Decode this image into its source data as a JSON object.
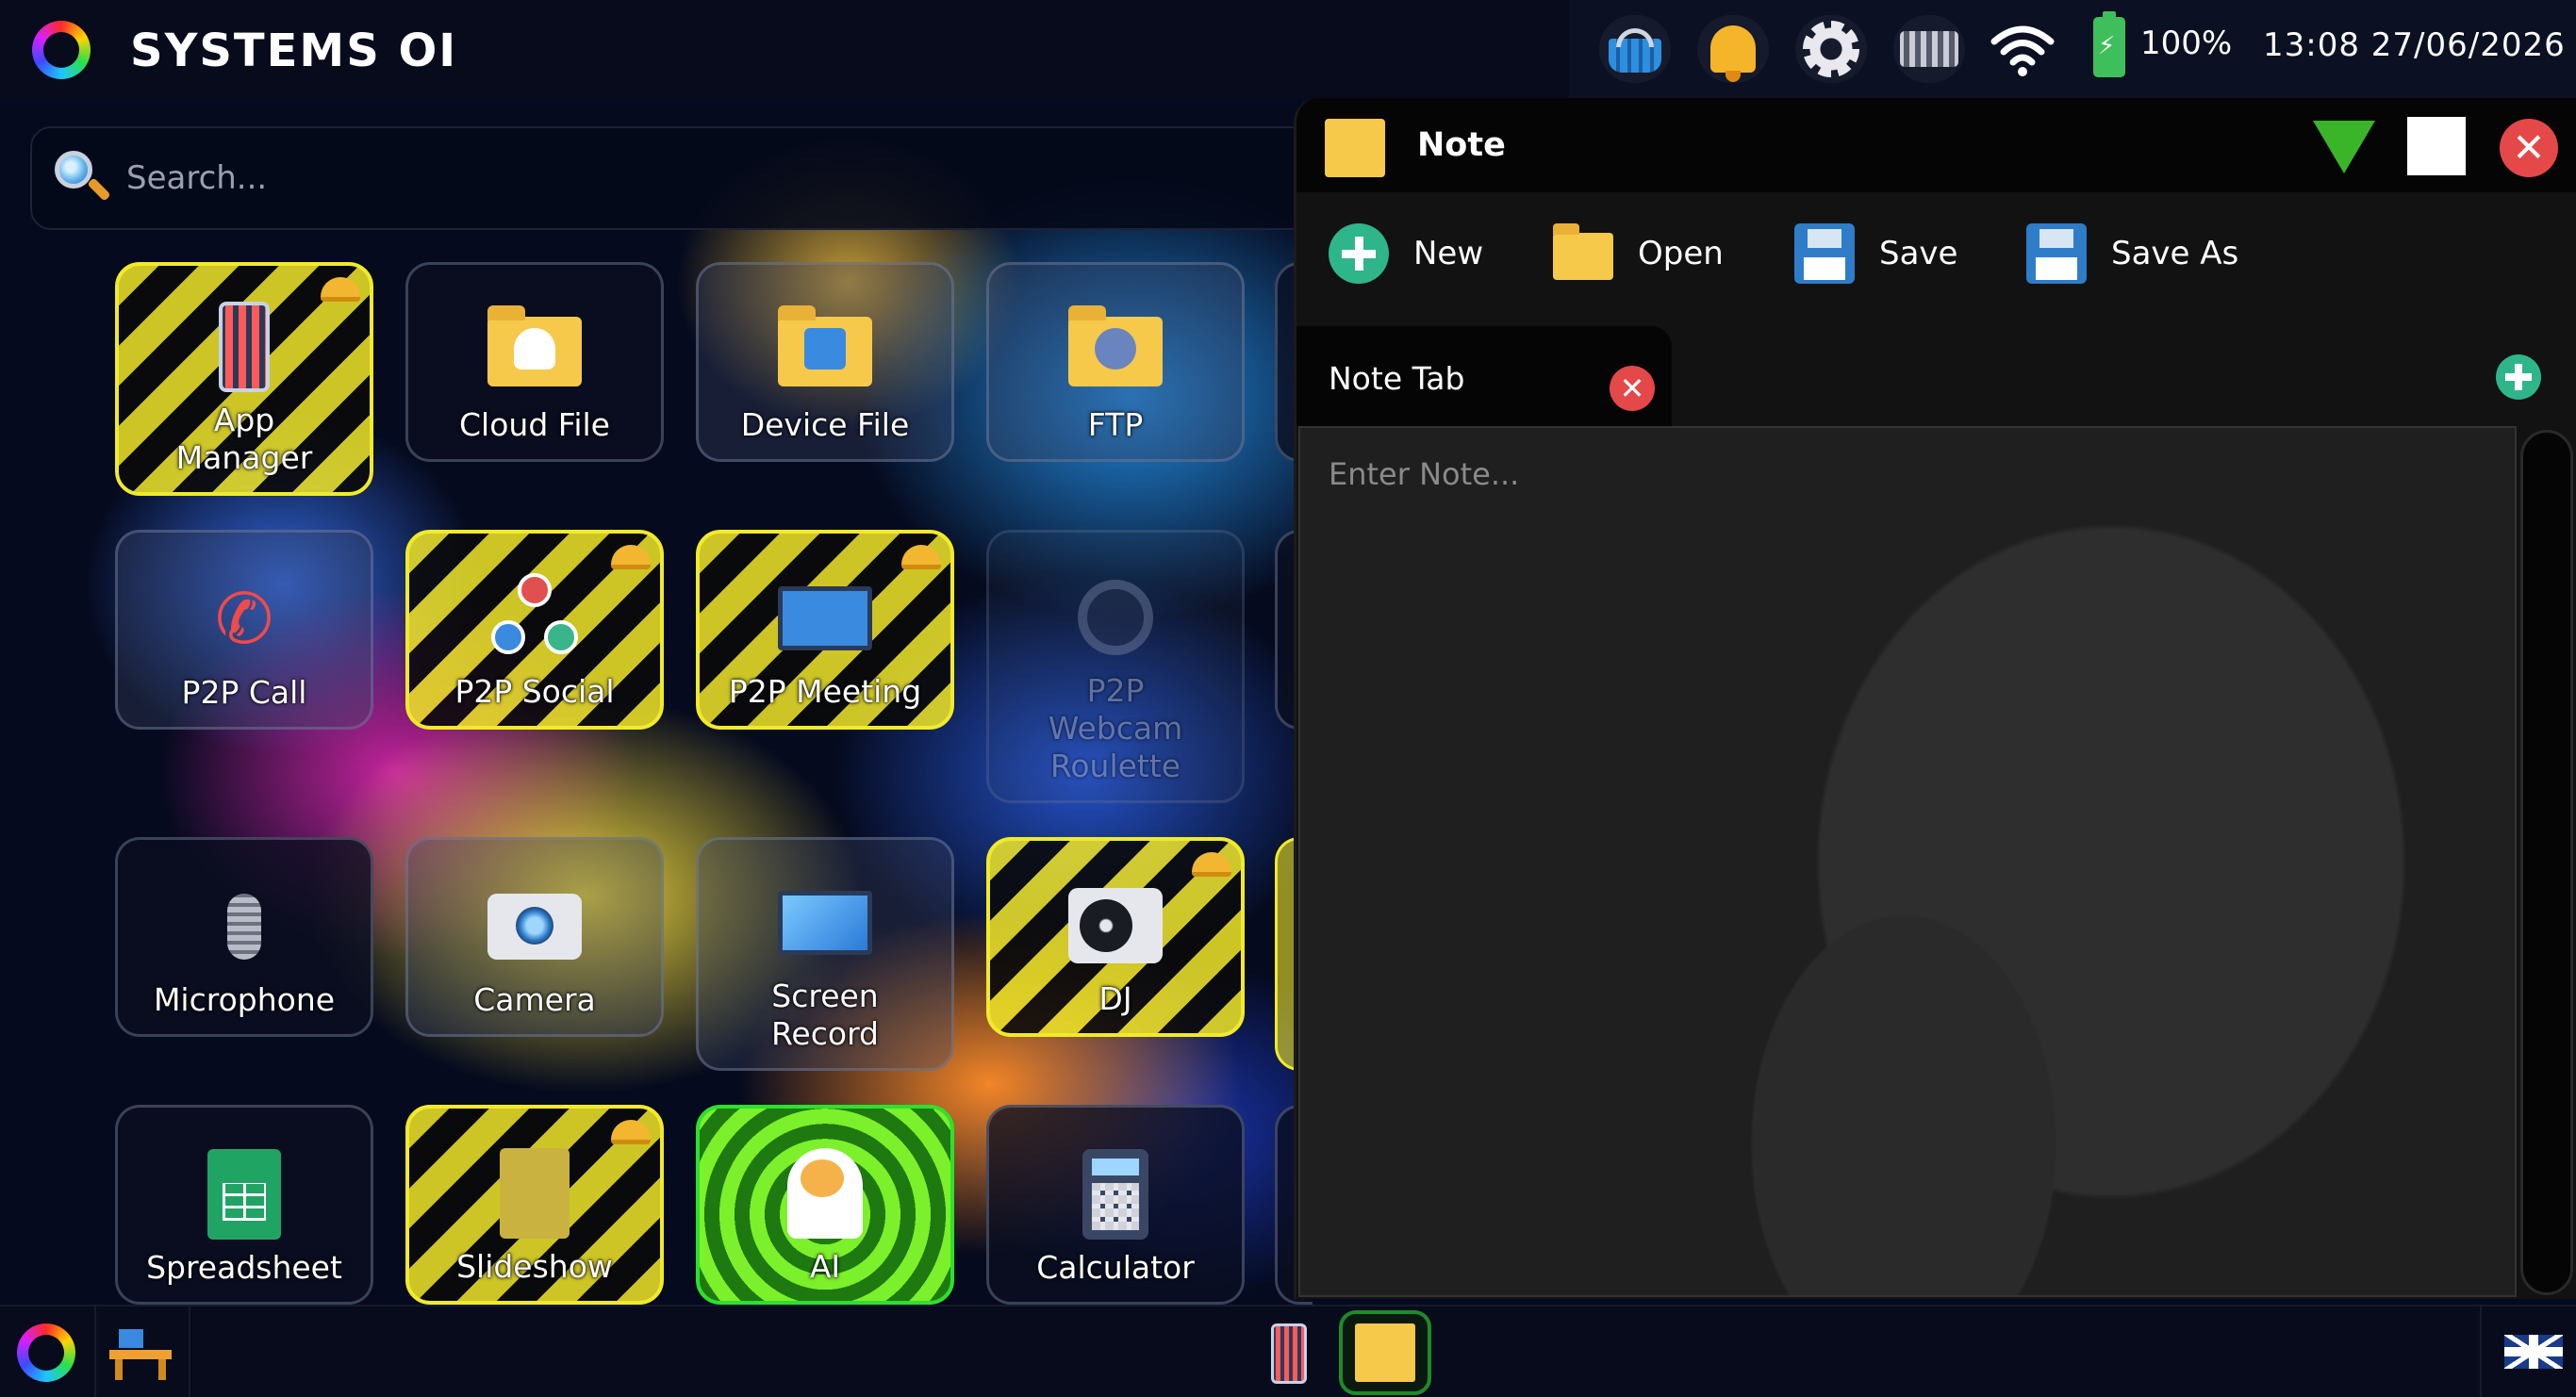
{
  "topbar": {
    "brand": "SYSTEMS OI",
    "battery": "100%",
    "clock": "13:08 27/06/2026",
    "tray_icons": [
      "basket-icon",
      "bell-icon",
      "gear-icon",
      "keyboard-icon",
      "wifi-icon",
      "battery-icon"
    ]
  },
  "search": {
    "placeholder": "Search..."
  },
  "apps": [
    {
      "label": "App\nManager",
      "icon": "phone-apps-icon",
      "style": "hazard"
    },
    {
      "label": "Cloud File",
      "icon": "cloud-folder-icon",
      "style": "normal"
    },
    {
      "label": "Device File",
      "icon": "device-folder-icon",
      "style": "glass"
    },
    {
      "label": "FTP",
      "icon": "globe-folder-icon",
      "style": "glass"
    },
    {
      "label": "P2P Call",
      "icon": "phone-handset-icon",
      "style": "glass"
    },
    {
      "label": "P2P Social",
      "icon": "people-network-icon",
      "style": "hazard"
    },
    {
      "label": "P2P Meeting",
      "icon": "meeting-presenter-icon",
      "style": "hazard"
    },
    {
      "label": "P2P\nWebcam\nRoulette",
      "icon": "webcam-icon",
      "style": "dim"
    },
    {
      "label": "Microphone",
      "icon": "microphone-icon",
      "style": "normal"
    },
    {
      "label": "Camera",
      "icon": "camera-icon",
      "style": "glass"
    },
    {
      "label": "Screen\nRecord",
      "icon": "monitor-icon",
      "style": "glass"
    },
    {
      "label": "DJ",
      "icon": "turntable-icon",
      "style": "hazard"
    },
    {
      "label": "Spreadsheet",
      "icon": "spreadsheet-icon",
      "style": "normal"
    },
    {
      "label": "Slideshow",
      "icon": "slideshow-icon",
      "style": "hazard"
    },
    {
      "label": "AI",
      "icon": "brain-head-icon",
      "style": "ai"
    },
    {
      "label": "Calculator",
      "icon": "calculator-icon",
      "style": "normal"
    }
  ],
  "note_window": {
    "title": "Note",
    "toolbar": {
      "new_label": "New",
      "open_label": "Open",
      "save_label": "Save",
      "save_as_label": "Save As"
    },
    "tab_label": "Note Tab",
    "note_placeholder": "Enter Note...",
    "note_value": ""
  },
  "taskbar": {
    "items": [
      "start-icon",
      "desk-icon",
      "phone-apps-icon",
      "note-icon"
    ],
    "language": "uk-flag-icon"
  },
  "colors": {
    "hazard_yellow": "#f1ea2a",
    "ai_green": "#2ee02e",
    "close_red": "#e54848",
    "add_green": "#2fb58a",
    "note_yellow": "#f6c94a"
  }
}
